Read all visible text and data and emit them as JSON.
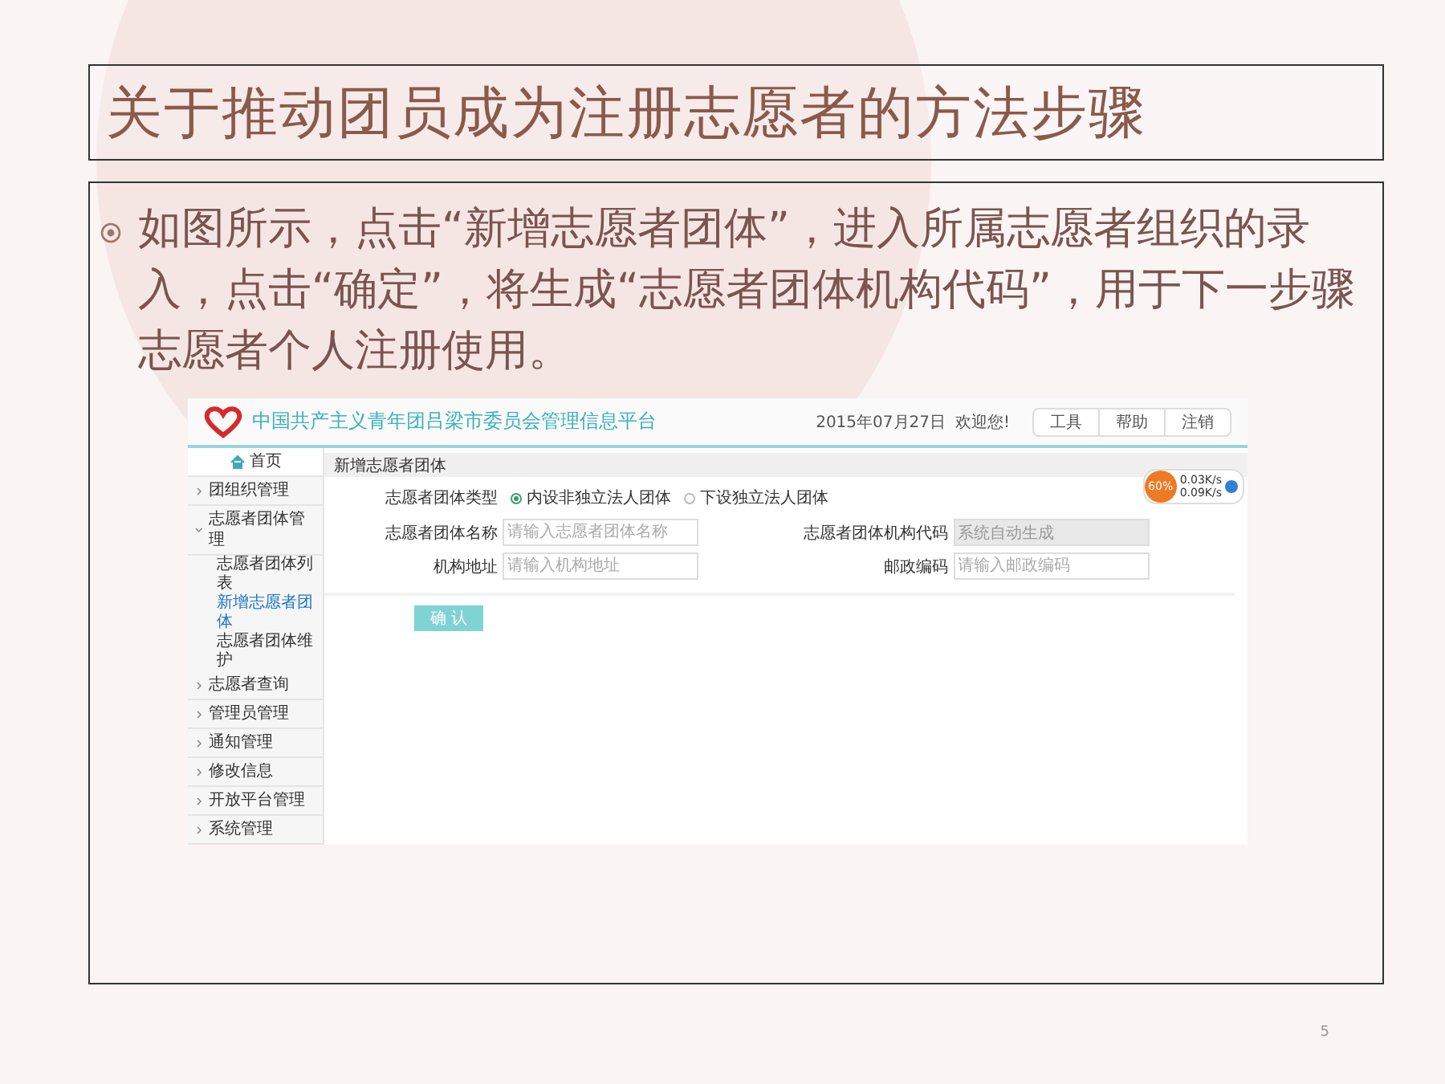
{
  "slide": {
    "title": "关于推动团员成为注册志愿者的方法步骤",
    "bullets": [
      "如图所示，点击“新增志愿者团体”，进入所属志愿者组织的录入，点击“确定”，将生成“志愿者团体机构代码”，用于下一步骤志愿者个人注册使用。"
    ],
    "page_number": "5"
  },
  "screenshot": {
    "header": {
      "platform_title": "中国共产主义青年团吕梁市委员会管理信息平台",
      "date": "2015年07月27日",
      "greeting": "欢迎您!",
      "links": [
        "工具",
        "帮助",
        "注销"
      ]
    },
    "sidebar": {
      "items": [
        {
          "label": "首页",
          "kind": "home"
        },
        {
          "label": "团组织管理",
          "kind": "group",
          "expanded": false
        },
        {
          "label": "志愿者团体管理",
          "kind": "group",
          "expanded": true,
          "children": [
            {
              "label": "志愿者团体列表",
              "selected": false
            },
            {
              "label": "新增志愿者团体",
              "selected": true
            },
            {
              "label": "志愿者团体维护",
              "selected": false
            }
          ]
        },
        {
          "label": "志愿者查询",
          "kind": "group",
          "expanded": false
        },
        {
          "label": "管理员管理",
          "kind": "group",
          "expanded": false
        },
        {
          "label": "通知管理",
          "kind": "group",
          "expanded": false
        },
        {
          "label": "修改信息",
          "kind": "group",
          "expanded": false
        },
        {
          "label": "开放平台管理",
          "kind": "group",
          "expanded": false
        },
        {
          "label": "系统管理",
          "kind": "group",
          "expanded": false
        }
      ]
    },
    "tab": "新增志愿者团体",
    "form": {
      "type_label": "志愿者团体类型",
      "type_options": [
        {
          "label": "内设非独立法人团体",
          "selected": true
        },
        {
          "label": "下设独立法人团体",
          "selected": false
        }
      ],
      "fields": [
        {
          "label": "志愿者团体名称",
          "placeholder": "请输入志愿者团体名称",
          "disabled": false
        },
        {
          "label": "志愿者团体机构代码",
          "value": "系统自动生成",
          "disabled": true
        },
        {
          "label": "机构地址",
          "placeholder": "请输入机构地址",
          "disabled": false
        },
        {
          "label": "邮政编码",
          "placeholder": "请输入邮政编码",
          "disabled": false
        }
      ],
      "submit": "确 认"
    },
    "speed_widget": {
      "percent": "60%",
      "upload": "0.03K/s",
      "download": "0.09K/s"
    }
  }
}
